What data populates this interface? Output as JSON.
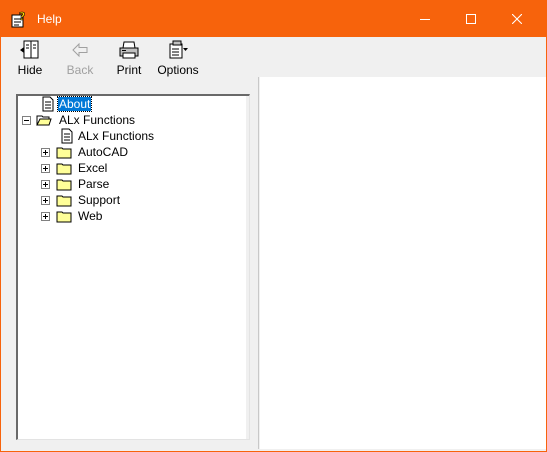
{
  "window": {
    "title": "Help",
    "accent_color": "#f7630c"
  },
  "toolbar": {
    "hide_label": "Hide",
    "back_label": "Back",
    "print_label": "Print",
    "options_label": "Options"
  },
  "tree": {
    "selected": "About",
    "nodes": [
      {
        "label": "About",
        "type": "page",
        "level": 0
      },
      {
        "label": "ALx Functions",
        "type": "folder-open",
        "level": 0,
        "expanded": true
      },
      {
        "label": "ALx Functions",
        "type": "page",
        "level": 1
      },
      {
        "label": "AutoCAD",
        "type": "folder",
        "level": 1,
        "expanded": false
      },
      {
        "label": "Excel",
        "type": "folder",
        "level": 1,
        "expanded": false
      },
      {
        "label": "Parse",
        "type": "folder",
        "level": 1,
        "expanded": false
      },
      {
        "label": "Support",
        "type": "folder",
        "level": 1,
        "expanded": false
      },
      {
        "label": "Web",
        "type": "folder",
        "level": 1,
        "expanded": false
      }
    ]
  }
}
